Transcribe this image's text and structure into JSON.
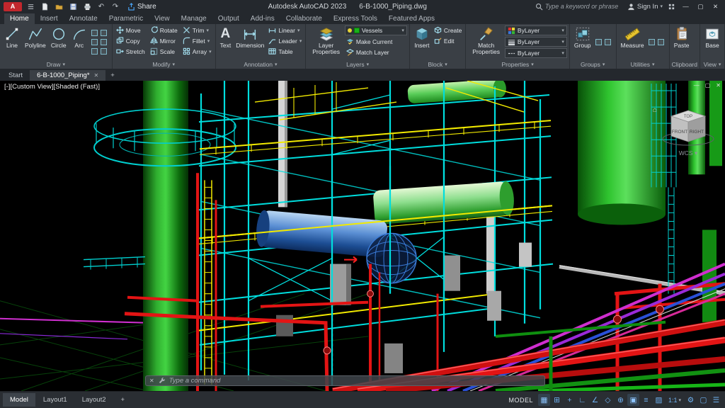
{
  "colors": {
    "accent_red": "#c2272d",
    "titlebar_bg": "#24282d",
    "ribbon_bg": "#3a3f45",
    "viewport_bg": "#000000",
    "structure_cyan": "#00dede",
    "rail_yellow": "#f2ea00",
    "pipe_red": "#e31414",
    "vessel_green": "#2fae2f",
    "vessel_blue": "#5b8fd4",
    "pipe_magenta": "#cf2ecf",
    "status_icon_blue": "#6fb2f2"
  },
  "titlebar": {
    "logo_text": "A",
    "share": "Share",
    "app_title": "Autodesk AutoCAD 2023",
    "doc_title": "6-B-1000_Piping.dwg",
    "search_placeholder": "Type a keyword or phrase",
    "sign_in": "Sign In",
    "undo": "↶",
    "redo": "↷",
    "minimize": "—",
    "maximize": "▢",
    "close": "✕",
    "dropdown": "▾"
  },
  "ribbon": {
    "tabs": [
      "Home",
      "Insert",
      "Annotate",
      "Parametric",
      "View",
      "Manage",
      "Output",
      "Add-ins",
      "Collaborate",
      "Express Tools",
      "Featured Apps"
    ],
    "arrow": "▾",
    "draw": {
      "label": "Draw",
      "line": "Line",
      "polyline": "Polyline",
      "circle": "Circle",
      "arc": "Arc"
    },
    "modify": {
      "label": "Modify",
      "move": "Move",
      "rotate": "Rotate",
      "trim": "Trim",
      "copy": "Copy",
      "mirror": "Mirror",
      "fillet": "Fillet",
      "stretch": "Stretch",
      "scale": "Scale",
      "array": "Array"
    },
    "annotation": {
      "label": "Annotation",
      "text_glyph": "A",
      "text": "Text",
      "dimension": "Dimension",
      "linear": "Linear",
      "leader": "Leader",
      "table": "Table"
    },
    "layers": {
      "label": "Layers",
      "layer_properties": "Layer Properties",
      "current_layer": "Vessels",
      "make_current": "Make Current",
      "match_layer": "Match Layer"
    },
    "block": {
      "label": "Block",
      "insert": "Insert",
      "create": "Create",
      "edit": "Edit"
    },
    "properties": {
      "label": "Properties",
      "match_properties": "Match Properties",
      "color_value": "ByLayer",
      "lineweight_value": "ByLayer",
      "linetype_value": "ByLayer"
    },
    "groups": {
      "label": "Groups",
      "group": "Group"
    },
    "utilities": {
      "label": "Utilities",
      "measure": "Measure"
    },
    "clipboard": {
      "label": "Clipboard",
      "paste": "Paste"
    },
    "view_panel": {
      "label": "View",
      "base": "Base"
    }
  },
  "doc_tabs": {
    "start": "Start",
    "active_doc": "6-B-1000_Piping*",
    "close": "✕",
    "add": "+"
  },
  "viewport": {
    "label": "[-][Custom View][Shaded (Fast)]",
    "min": "—",
    "max": "▢",
    "close": "✕",
    "home": "⌂",
    "viewcube_top": "TOP",
    "viewcube_front": "FRONT",
    "viewcube_right": "RIGHT",
    "wcs": "WCS ▾"
  },
  "command": {
    "close": "✕",
    "placeholder": "Type a command"
  },
  "statusbar": {
    "model_tab": "Model",
    "layout1": "Layout1",
    "layout2": "Layout2",
    "add_layout": "+",
    "model_space": "MODEL",
    "grid": "▦",
    "snap": "⊞",
    "infer": "+",
    "ortho": "∟",
    "polar": "∠",
    "isodraft": "◇",
    "otrack": "⊕",
    "osnap": "▣",
    "lineweight": "≡",
    "transparency": "▨",
    "scale": "1:1",
    "workspace": "⚙",
    "cleanscreen": "▢",
    "customize": "☰"
  }
}
